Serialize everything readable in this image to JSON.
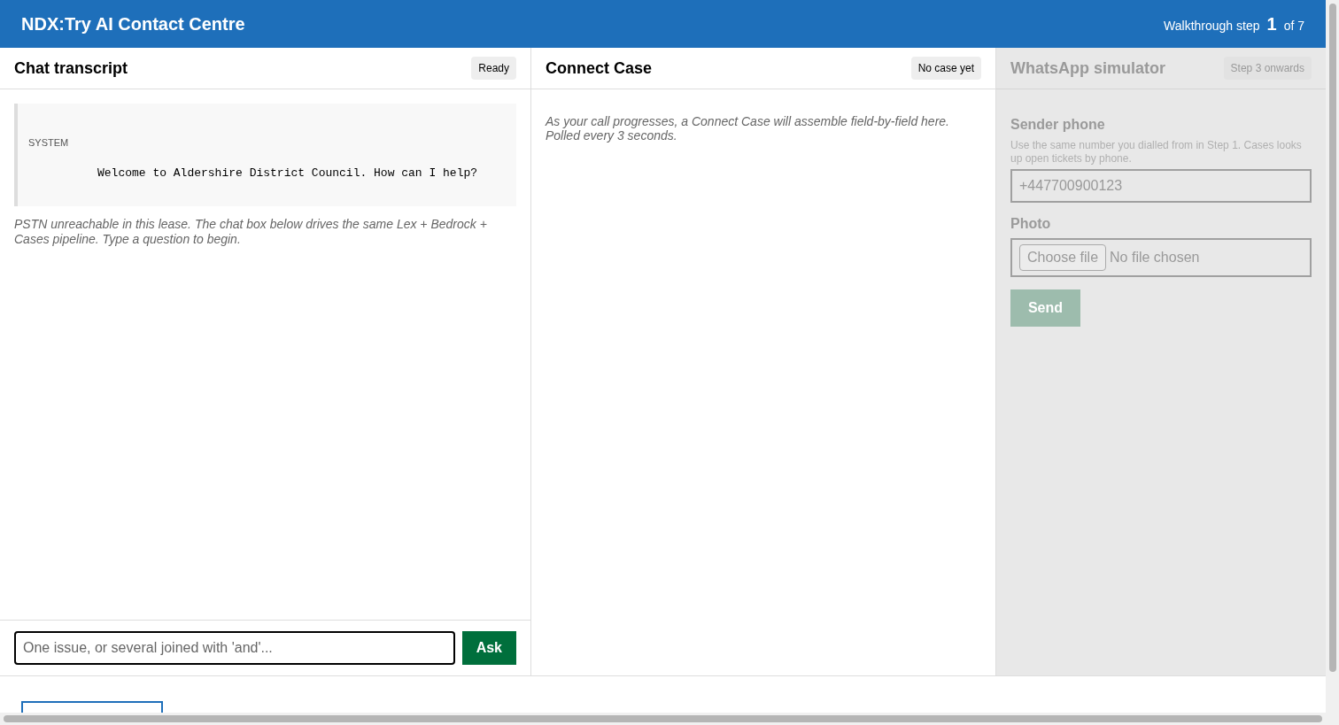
{
  "header": {
    "title": "NDX:Try AI Contact Centre",
    "step_label": "Walkthrough step",
    "step_number": "1",
    "step_total": "of 7"
  },
  "chat": {
    "title": "Chat transcript",
    "status": "Ready",
    "messages": [
      {
        "role": "SYSTEM",
        "text": "Welcome to Aldershire District Council. How can I help?"
      }
    ],
    "notice": "PSTN unreachable in this lease. The chat box below drives the same Lex + Bedrock + Cases pipeline. Type a question to begin.",
    "input": {
      "placeholder": "One issue, or several joined with 'and'..."
    },
    "button": "Ask"
  },
  "case": {
    "title": "Connect Case",
    "status": "No case yet",
    "notice": "As your call progresses, a Connect Case will assemble field-by-field here. Polled every 3 seconds."
  },
  "whatsapp": {
    "title": "WhatsApp simulator",
    "badge": "Step 3 onwards",
    "disabled": true,
    "phone_label": "Sender phone",
    "phone_hint": "Use the same number you dialled from in Step 1. Cases looks up open tickets by phone.",
    "phone_placeholder": "+447700900123",
    "photo_label": "Photo",
    "file_button": "Choose file",
    "file_status": "No file chosen",
    "send": "Send"
  }
}
